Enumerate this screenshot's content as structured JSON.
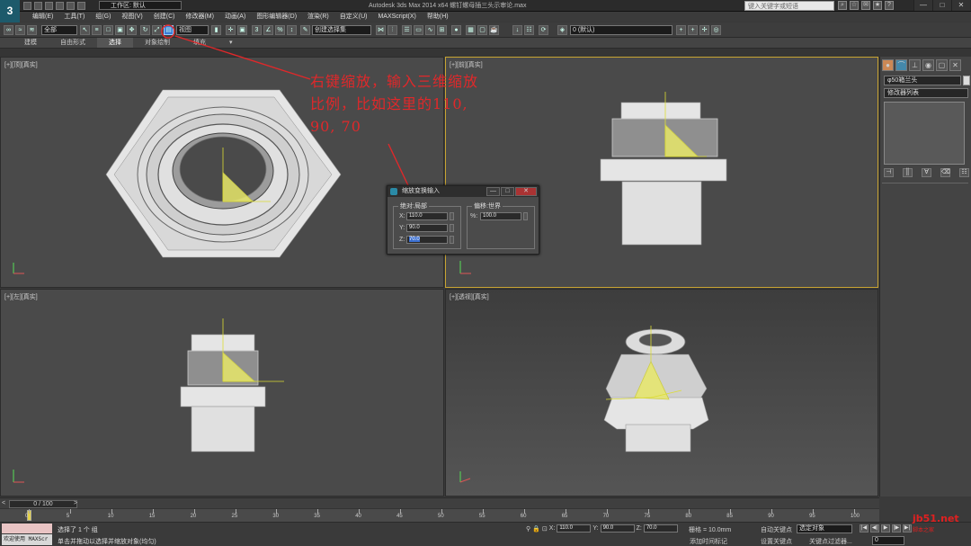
{
  "window": {
    "logo": "3",
    "workspace": "工作区: 默认",
    "title": "Autodesk 3ds Max  2014 x64    螺钉螺母插三头示审论.max",
    "search_placeholder": "键入关键字或短语",
    "buttons": [
      "—",
      "□",
      "✕"
    ]
  },
  "menu": [
    "编辑(E)",
    "工具(T)",
    "组(G)",
    "视图(V)",
    "创建(C)",
    "修改器(M)",
    "动画(A)",
    "图形编辑器(D)",
    "渲染(R)",
    "自定义(U)",
    "MAXScript(X)",
    "帮助(H)"
  ],
  "toolbar": {
    "selection_filter": "全部",
    "ref_coord": "视图",
    "named_selection": "创建选择集",
    "layer": "0 (默认)"
  },
  "ribbon": {
    "tabs": [
      "建模",
      "自由形式",
      "选择",
      "对象绘制",
      "填充"
    ],
    "active": "选择"
  },
  "viewports": {
    "top_left": "[+][顶][真实]",
    "top_right": "[+][前][真实]",
    "bottom_left": "[+][左][真实]",
    "bottom_right": "[+][透视][真实]"
  },
  "annotation": "右键缩放，输入三维缩放比例，比如这里的110, 90, 70",
  "dialog": {
    "title": "缩放变换输入",
    "absolute_group": "绝对:局部",
    "offset_group": "偏移:世界",
    "x_label": "X:",
    "x_value": "110.0",
    "y_label": "Y:",
    "y_value": "90.0",
    "z_label": "Z:",
    "z_value": "70.0",
    "percent_label": "%:",
    "percent_value": "100.0"
  },
  "command_panel": {
    "object_name": "φ50箱兰头",
    "modifier_list": "修改器列表",
    "tab_icons": [
      "sun-icon",
      "bend-icon",
      "hierarchy-icon",
      "motion-icon",
      "display-icon",
      "utilities-icon"
    ]
  },
  "timeline": {
    "range": "0 / 100",
    "ticks": [
      "0",
      "5",
      "10",
      "15",
      "20",
      "25",
      "30",
      "35",
      "40",
      "45",
      "50",
      "55",
      "60",
      "65",
      "70",
      "75",
      "80",
      "85",
      "90",
      "95",
      "100"
    ]
  },
  "status": {
    "maxscript": "欢迎使用 MAXScr",
    "selected": "选择了 1 个 组",
    "prompt": "单击并拖动以选择并缩放对象(均匀)",
    "x": "110.0",
    "y": "90.0",
    "z": "70.0",
    "x_label": "X:",
    "y_label": "Y:",
    "z_label": "Z:",
    "grid": "栅格 = 10.0mm",
    "add_time_tag": "添加时间标记",
    "auto_key": "自动关键点",
    "set_key": "设置关键点",
    "selection_set": "选定对象",
    "key_filters": "关键点过滤器...",
    "frame": "0"
  },
  "watermark": {
    "line1": "jb51.net",
    "line2": "脚本之家"
  },
  "colors": {
    "accent_active_viewport": "#c8a432",
    "annotation": "#e0282a",
    "dialog_close": "#aa3333",
    "gizmo": "#e8e86a"
  }
}
